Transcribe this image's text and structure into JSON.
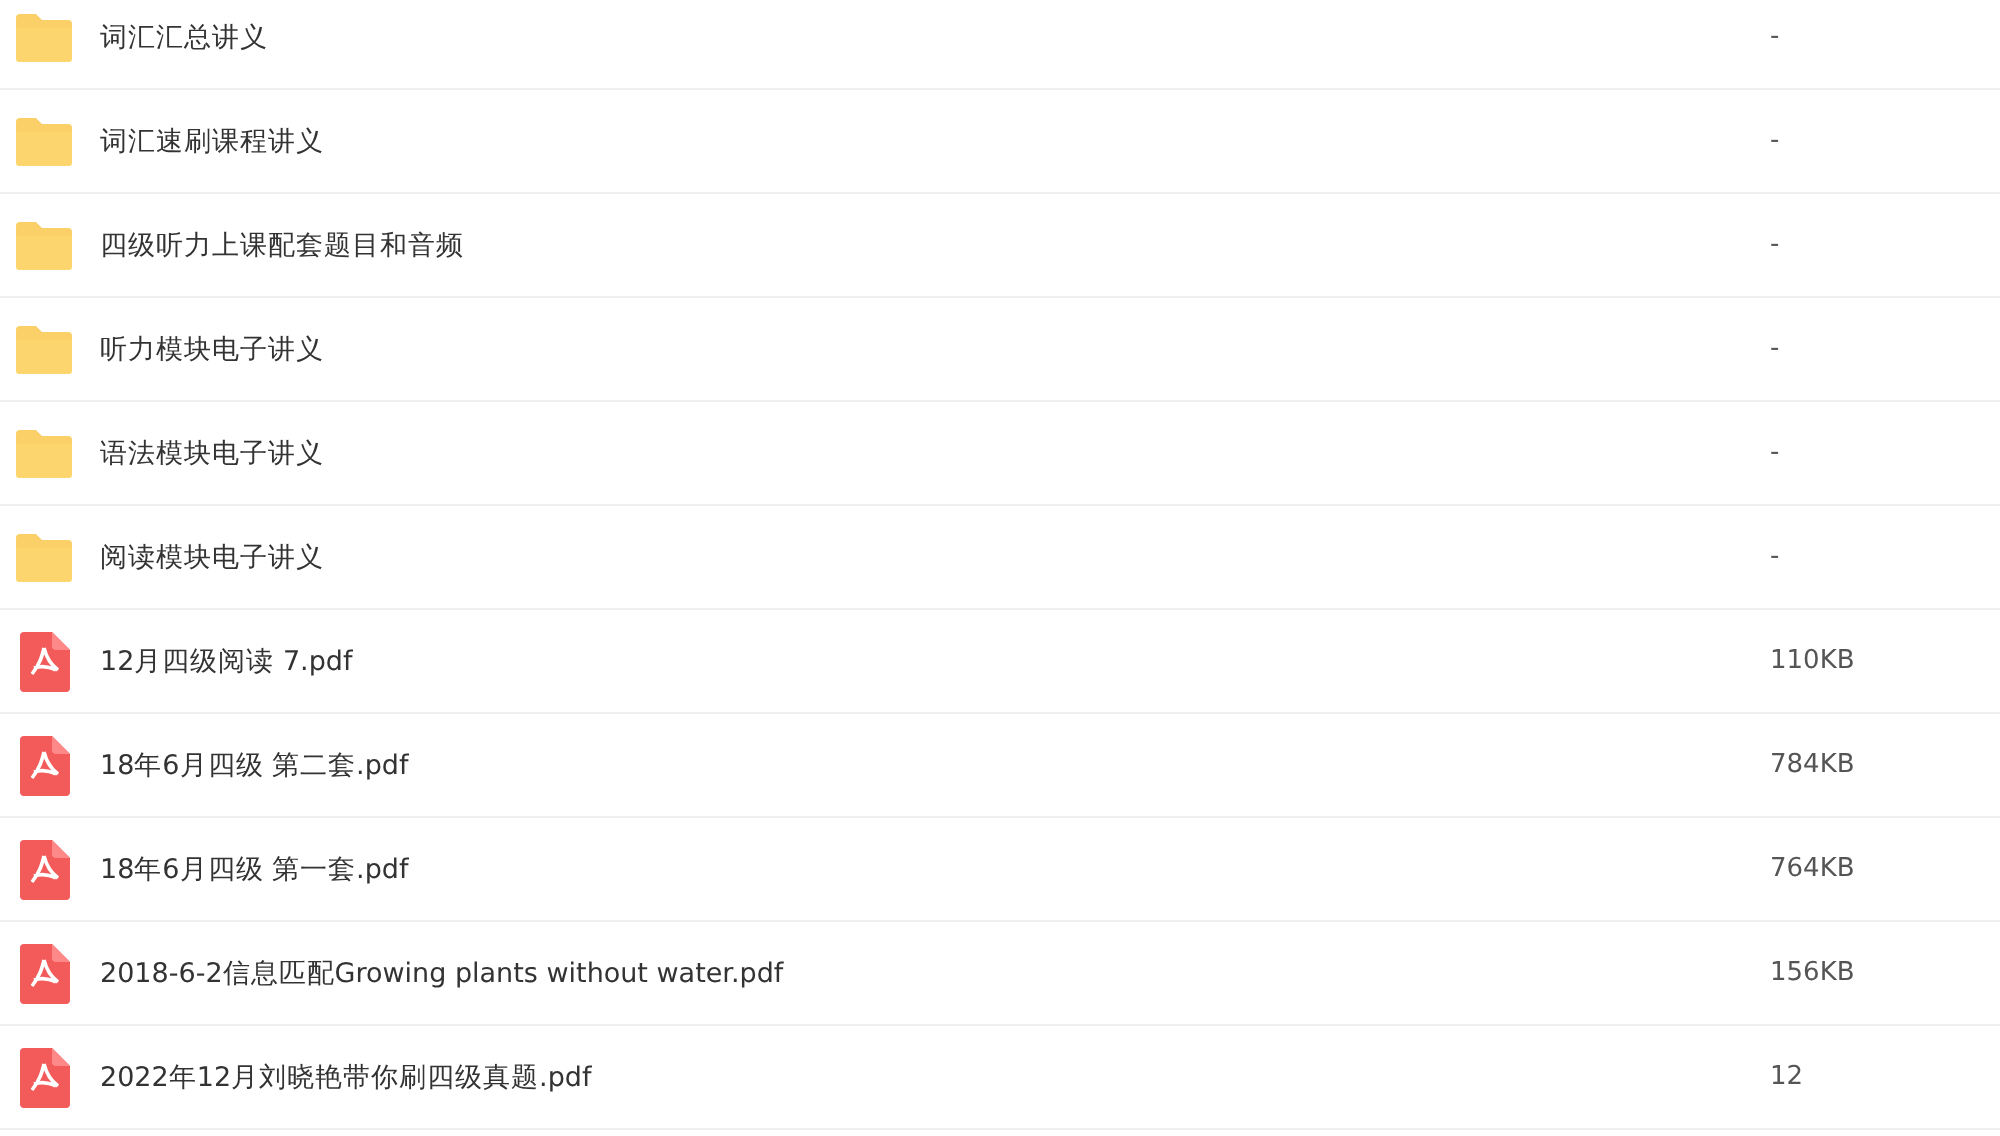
{
  "files": [
    {
      "kind": "folder",
      "name": "词汇汇总讲义",
      "size": "-"
    },
    {
      "kind": "folder",
      "name": "词汇速刷课程讲义",
      "size": "-"
    },
    {
      "kind": "folder",
      "name": "四级听力上课配套题目和音频",
      "size": "-"
    },
    {
      "kind": "folder",
      "name": "听力模块电子讲义",
      "size": "-"
    },
    {
      "kind": "folder",
      "name": "语法模块电子讲义",
      "size": "-"
    },
    {
      "kind": "folder",
      "name": "阅读模块电子讲义",
      "size": "-"
    },
    {
      "kind": "pdf",
      "name": "12月四级阅读 7.pdf",
      "size": "110KB"
    },
    {
      "kind": "pdf",
      "name": "18年6月四级 第二套.pdf",
      "size": "784KB"
    },
    {
      "kind": "pdf",
      "name": "18年6月四级 第一套.pdf",
      "size": "764KB"
    },
    {
      "kind": "pdf",
      "name": "2018-6-2信息匹配Growing plants without water.pdf",
      "size": "156KB"
    },
    {
      "kind": "pdf",
      "name": "2022年12月刘晓艳带你刷四级真题.pdf",
      "size": "12"
    }
  ]
}
